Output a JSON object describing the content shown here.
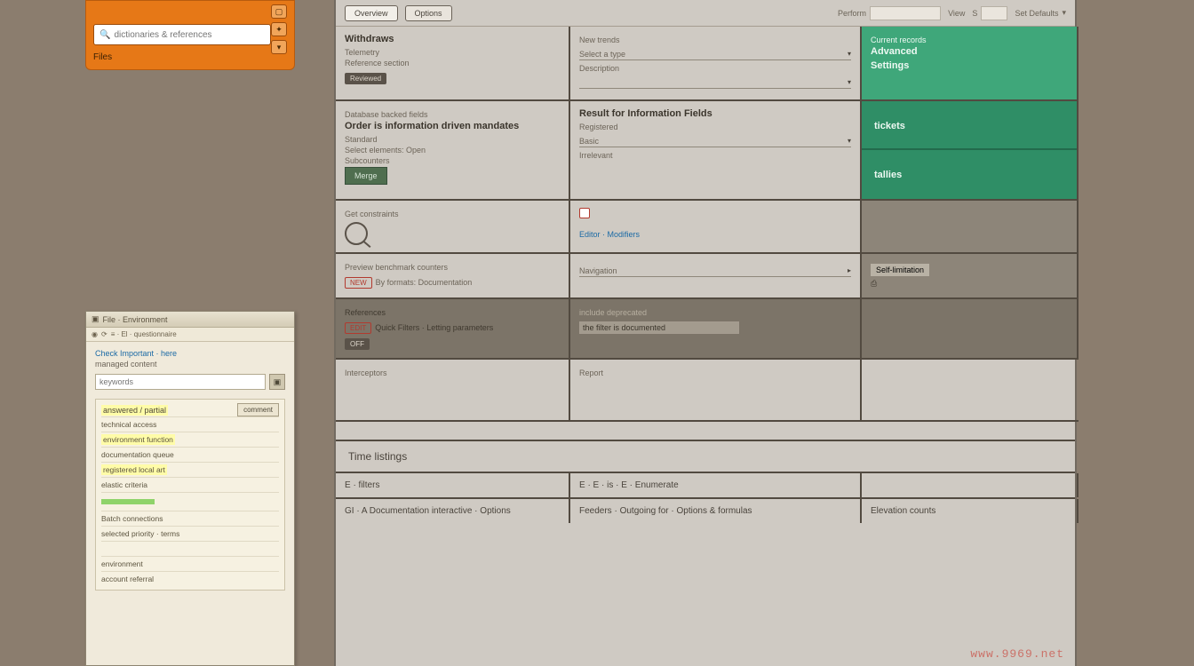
{
  "orange": {
    "search_placeholder": "dictionaries & references",
    "label": "Files",
    "icons": [
      "maximize-icon",
      "pin-icon",
      "filter-icon"
    ]
  },
  "toolbar": {
    "btn1": "Overview",
    "btn2": "Options",
    "field_perform": "Perform",
    "field_view": "View",
    "field_version_label": "S",
    "field_defaults": "Set Defaults"
  },
  "grid": {
    "r1": {
      "c1": {
        "title": "Withdraws",
        "sub1": "Telemetry",
        "sub2": "Reference section",
        "badge": "Reviewed"
      },
      "c2": {
        "sub1": "New trends",
        "dd1": "Select a type",
        "sub2": "Description"
      },
      "c3": {
        "line1": "Current records",
        "line2": "Advanced",
        "line3": "Settings"
      }
    },
    "r2": {
      "c1": {
        "pre": "Database backed fields",
        "title": "Order is information driven mandates",
        "sub1": "Standard",
        "sub2": "Select elements: Open",
        "sub3": "Subcounters",
        "btn": "Merge"
      },
      "c2": {
        "title": "Result for Information Fields",
        "sub1": "Registered",
        "sub2": "Basic",
        "sub3": "Irrelevant"
      },
      "c3": {
        "title": "tickets",
        "title2": "tallies"
      }
    },
    "r3": {
      "c1": {
        "sub": "Get constraints"
      },
      "c2": {
        "link": "Editor · Modifiers"
      },
      "c3": {}
    },
    "r4": {
      "c1": {
        "sub": "Preview benchmark counters",
        "stamp": "NEW",
        "text": "By formats: Documentation"
      },
      "c2": {
        "text": "Navigation"
      },
      "c3": {
        "text": "Self-limitation"
      }
    },
    "r5": {
      "c1": {
        "sub": "References",
        "stamp": "EDIT",
        "text": "Quick Filters · Letting parameters",
        "badge": "OFF"
      },
      "c2": {
        "hint": "include deprecated",
        "field": "the filter is documented"
      },
      "c3": {}
    },
    "r6": {
      "c1": {
        "text": "Interceptors"
      },
      "c2": {
        "text": "Report"
      },
      "c3": {}
    }
  },
  "section2": {
    "title": "Time listings",
    "row_a": {
      "c1": "E · filters",
      "c2": "E · E · is · E · Enumerate",
      "c3": ""
    },
    "row_b": {
      "c1": "GI · A Documentation interactive · Options",
      "c2": "Feeders · Outgoing for · Options & formulas",
      "c3": "Elevation counts"
    }
  },
  "mini": {
    "title": "File · Environment",
    "addr": "≡ · El · questionnaire",
    "link": "Check Important · here",
    "sub": "managed content",
    "search_placeholder": "keywords",
    "header": "answered / partial",
    "post_btn": "comment",
    "items": [
      "technical access",
      "environment function",
      "documentation queue",
      "registered local art",
      "elastic criteria",
      "",
      "Batch connections",
      "selected priority · terms",
      "",
      "environment",
      "account referral"
    ]
  },
  "watermark": "www.9969.net"
}
